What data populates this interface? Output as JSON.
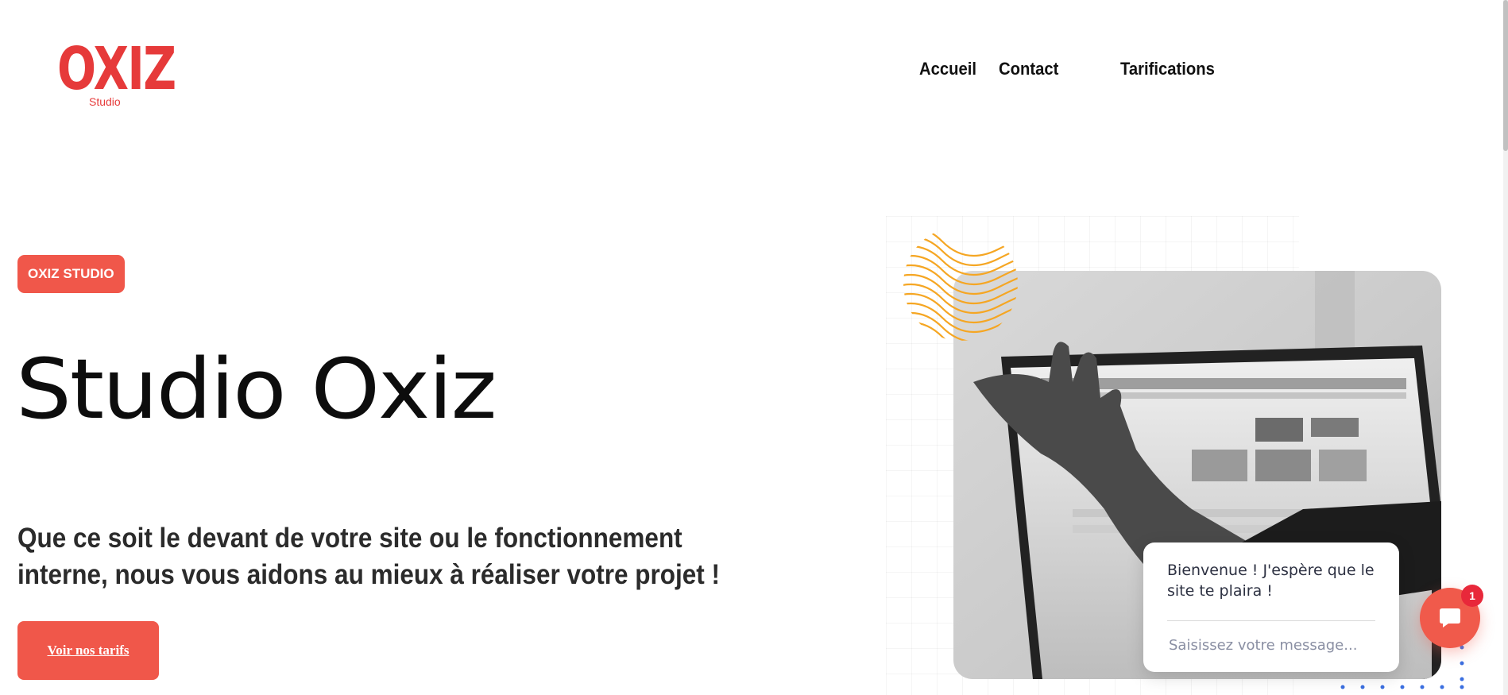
{
  "brand": {
    "name": "OXIZ",
    "subtitle": "Studio",
    "color": "#e63a3a"
  },
  "nav": {
    "items": [
      {
        "label": "Accueil"
      },
      {
        "label": "Contact"
      },
      {
        "label": "Tarifications"
      }
    ]
  },
  "hero": {
    "badge": "OXIZ STUDIO",
    "title": "Studio Oxiz",
    "description": "Que ce soit le devant de votre site ou le fonctionnement interne, nous vous aidons au mieux à réaliser votre projet !",
    "cta_label": "Voir nos tarifs",
    "image_icon": "laptop-hand-photo-icon"
  },
  "chat": {
    "welcome": "Bienvenue ! J'espère que le site te plaira !",
    "placeholder": "Saisissez votre message...",
    "unread_count": "1",
    "icon": "chat-icon"
  },
  "colors": {
    "accent": "#f0574a",
    "decor_orange": "#f5a623",
    "dots_blue": "#3b6fe0",
    "badge_red": "#e8283a"
  }
}
